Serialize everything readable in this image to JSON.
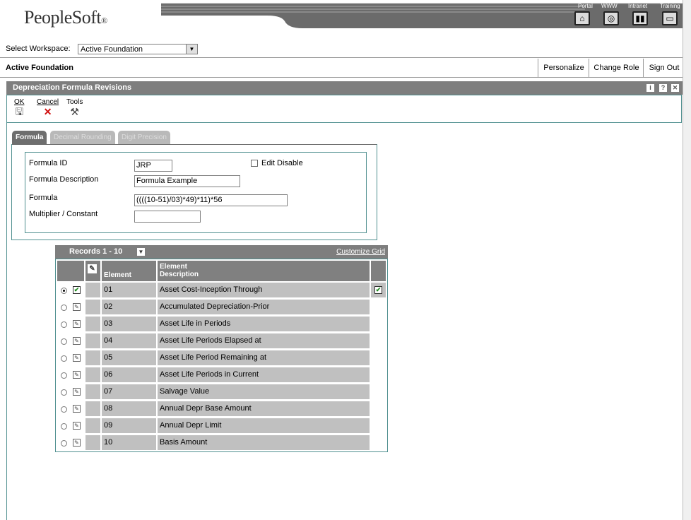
{
  "brand": {
    "logo": "PeopleSoft",
    "logo_mark": "®"
  },
  "topnav": {
    "items": [
      {
        "label": "Portal",
        "icon": "home-icon"
      },
      {
        "label": "WWW",
        "icon": "globe-icon"
      },
      {
        "label": "Intranet",
        "icon": "book-icon"
      },
      {
        "label": "Training",
        "icon": "monitor-icon"
      }
    ]
  },
  "workspace": {
    "label": "Select Workspace:",
    "selected": "Active Foundation",
    "current": "Active Foundation",
    "buttons": {
      "personalize": "Personalize",
      "change_role": "Change Role",
      "sign_out": "Sign Out"
    }
  },
  "form": {
    "title": "Depreciation Formula Revisions",
    "toolbar": {
      "ok": "OK",
      "cancel": "Cancel",
      "tools": "Tools"
    },
    "tabs": [
      "Formula",
      "Decimal Rounding",
      "Digit Precision"
    ],
    "active_tab": "Formula",
    "fields": {
      "formula_id_label": "Formula ID",
      "formula_id_value": "JRP",
      "edit_disable_label": "Edit Disable",
      "description_label": "Formula Description",
      "description_value": "Formula Example",
      "formula_label": "Formula",
      "formula_value": "((((10-51)/03)*49)*11)*56",
      "multiplier_label": "Multiplier / Constant",
      "multiplier_value": ""
    }
  },
  "grid": {
    "records_label": "Records 1 - 10",
    "customize_label": "Customize Grid",
    "columns": {
      "element": "Element",
      "description_line1": "Element",
      "description_line2": "Description"
    },
    "rows": [
      {
        "element": "01",
        "description": "Asset Cost-Inception Through",
        "selected": true
      },
      {
        "element": "02",
        "description": "Accumulated Depreciation-Prior",
        "selected": false
      },
      {
        "element": "03",
        "description": "Asset Life in Periods",
        "selected": false
      },
      {
        "element": "04",
        "description": "Asset Life Periods Elapsed at",
        "selected": false
      },
      {
        "element": "05",
        "description": "Asset Life Period Remaining at",
        "selected": false
      },
      {
        "element": "06",
        "description": "Asset Life Periods in Current",
        "selected": false
      },
      {
        "element": "07",
        "description": "Salvage Value",
        "selected": false
      },
      {
        "element": "08",
        "description": "Annual Depr Base Amount",
        "selected": false
      },
      {
        "element": "09",
        "description": "Annual Depr Limit",
        "selected": false
      },
      {
        "element": "10",
        "description": "Basis Amount",
        "selected": false
      }
    ]
  },
  "colors": {
    "title_bar": "#7e7e7e",
    "frame": "#4f8f8f",
    "grid_cell": "#c0c0c0",
    "check_green": "#1a8a1a",
    "cancel_red": "#d01010"
  }
}
